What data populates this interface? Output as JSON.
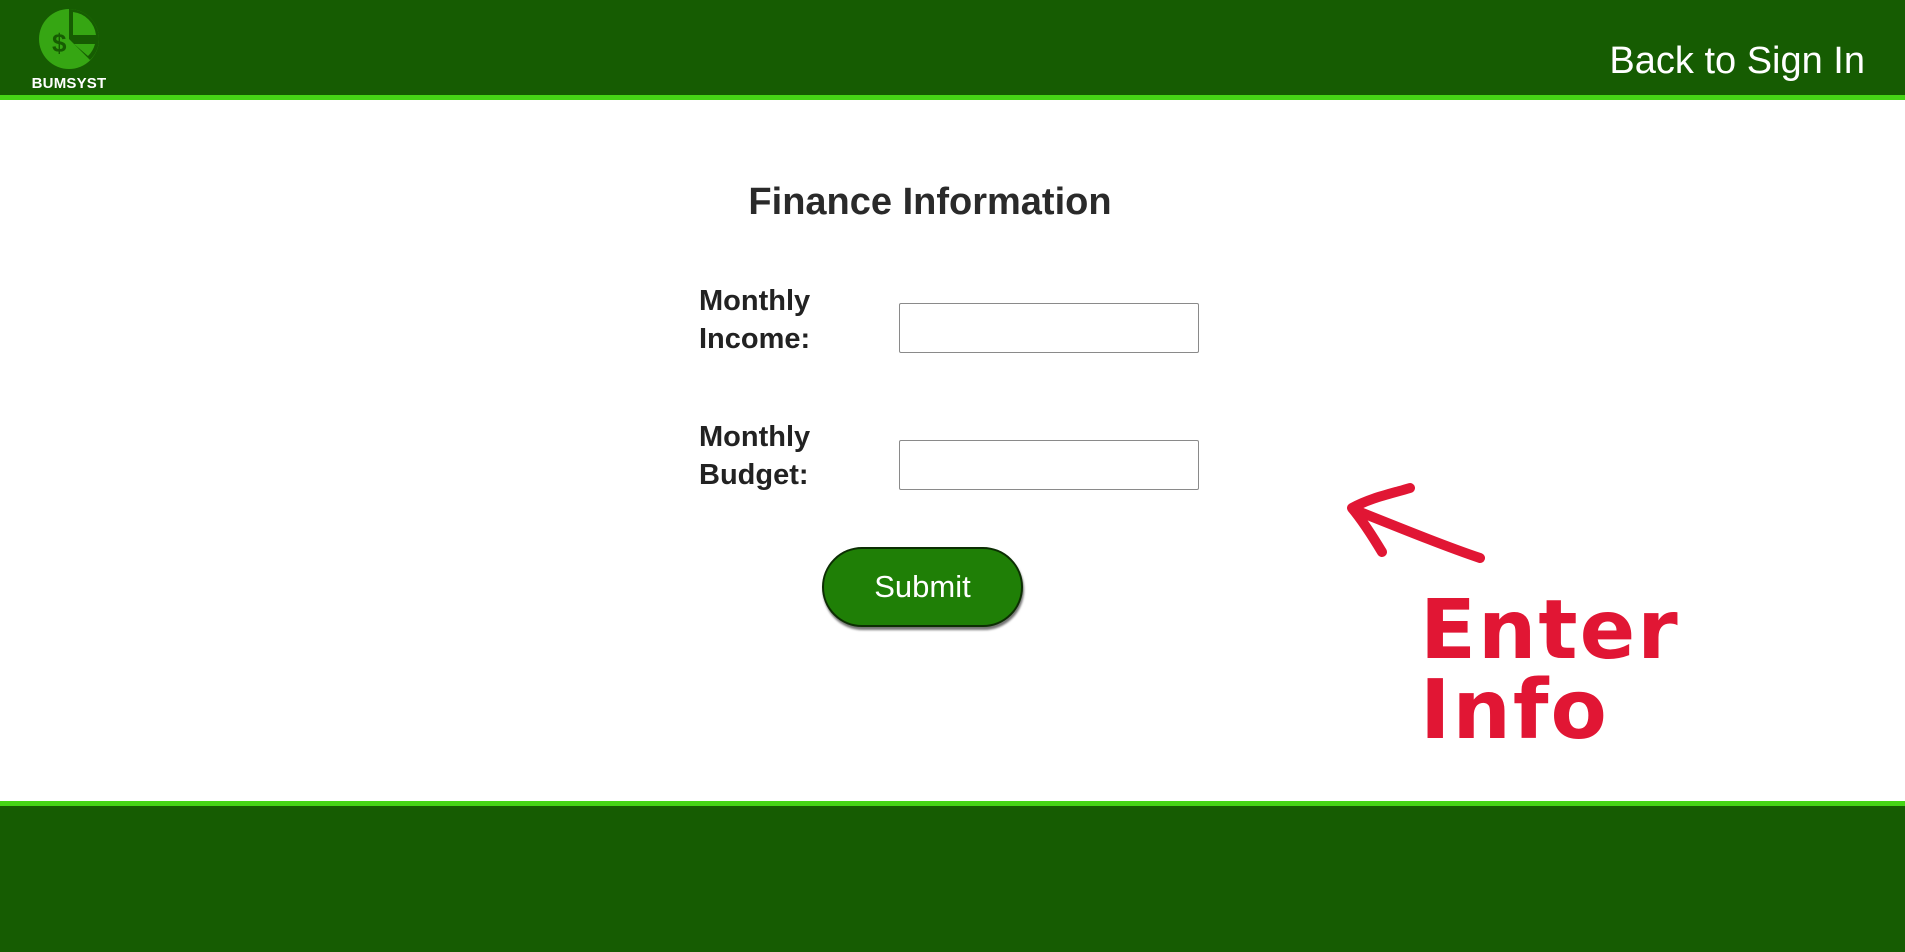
{
  "header": {
    "logo_text": "BUMSYST",
    "back_link": "Back to Sign In"
  },
  "form": {
    "title": "Finance Information",
    "income_label": "Monthly Income:",
    "income_value": "",
    "budget_label": "Monthly Budget:",
    "budget_value": "",
    "submit_label": "Submit"
  },
  "annotation": {
    "text_line1": "Enter",
    "text_line2": "Info",
    "color": "#e11634"
  },
  "colors": {
    "brand_dark": "#165c02",
    "brand_accent": "#46d416",
    "button": "#1f7f06"
  },
  "icons": {
    "logo": "pie-chart-dollar-icon",
    "annotation_arrow": "arrow-left-icon"
  }
}
